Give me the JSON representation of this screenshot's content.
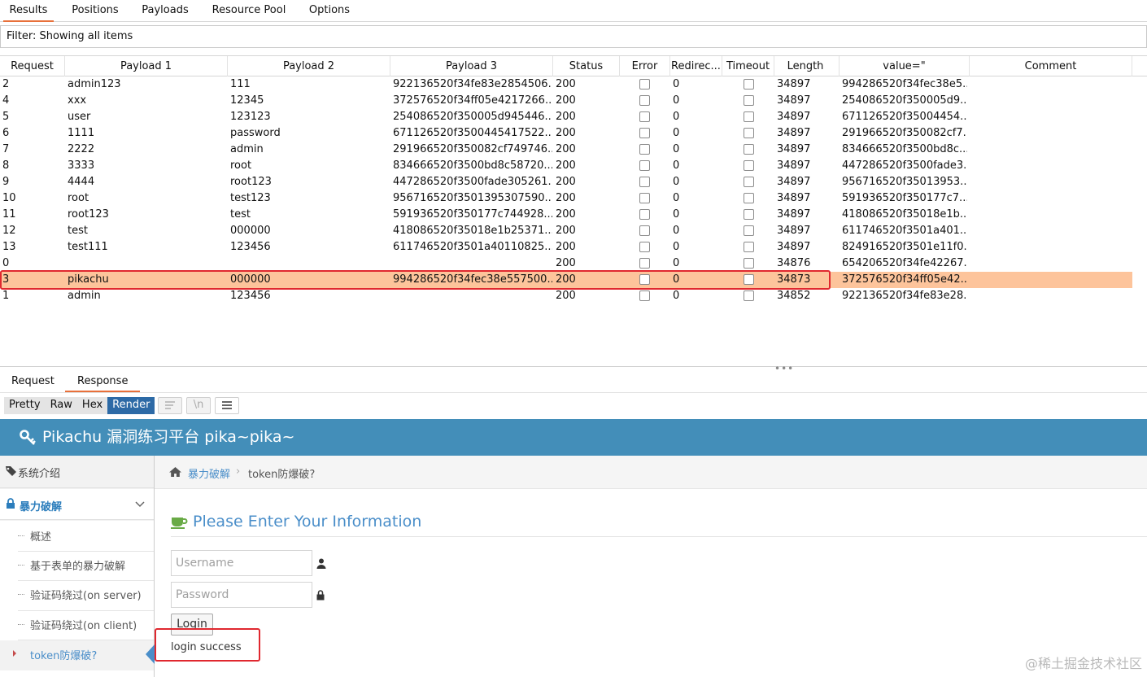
{
  "top_tabs": [
    "Results",
    "Positions",
    "Payloads",
    "Resource Pool",
    "Options"
  ],
  "filter": {
    "text": "Filter: Showing all items"
  },
  "table": {
    "columns": [
      "Request",
      "Payload 1",
      "Payload 2",
      "Payload 3",
      "Status",
      "Error",
      "Redirec...",
      "Timeout",
      "Length",
      "value=\"",
      "Comment"
    ],
    "sort_indicator": "⌄",
    "rows": [
      {
        "request": "2",
        "p1": "admin123",
        "p2": "111",
        "p3": "922136520f34fe83e2854506...",
        "status": "200",
        "redirects": "0",
        "length": "34897",
        "value": "994286520f34fec38e5...",
        "selected": false
      },
      {
        "request": "4",
        "p1": "xxx",
        "p2": "12345",
        "p3": "372576520f34ff05e4217266...",
        "status": "200",
        "redirects": "0",
        "length": "34897",
        "value": "254086520f350005d9...",
        "selected": false
      },
      {
        "request": "5",
        "p1": "user",
        "p2": "123123",
        "p3": "254086520f350005d945446...",
        "status": "200",
        "redirects": "0",
        "length": "34897",
        "value": "671126520f35004454...",
        "selected": false
      },
      {
        "request": "6",
        "p1": "1111",
        "p2": "password",
        "p3": "671126520f3500445417522...",
        "status": "200",
        "redirects": "0",
        "length": "34897",
        "value": "291966520f350082cf7...",
        "selected": false
      },
      {
        "request": "7",
        "p1": "2222",
        "p2": "admin",
        "p3": "291966520f350082cf749746...",
        "status": "200",
        "redirects": "0",
        "length": "34897",
        "value": "834666520f3500bd8c...",
        "selected": false
      },
      {
        "request": "8",
        "p1": "3333",
        "p2": "root",
        "p3": "834666520f3500bd8c58720...",
        "status": "200",
        "redirects": "0",
        "length": "34897",
        "value": "447286520f3500fade3...",
        "selected": false
      },
      {
        "request": "9",
        "p1": "4444",
        "p2": "root123",
        "p3": "447286520f3500fade305261...",
        "status": "200",
        "redirects": "0",
        "length": "34897",
        "value": "956716520f35013953...",
        "selected": false
      },
      {
        "request": "10",
        "p1": "root",
        "p2": "test123",
        "p3": "956716520f3501395307590...",
        "status": "200",
        "redirects": "0",
        "length": "34897",
        "value": "591936520f350177c7...",
        "selected": false
      },
      {
        "request": "11",
        "p1": "root123",
        "p2": "test",
        "p3": "591936520f350177c744928...",
        "status": "200",
        "redirects": "0",
        "length": "34897",
        "value": "418086520f35018e1b...",
        "selected": false
      },
      {
        "request": "12",
        "p1": "test",
        "p2": "000000",
        "p3": "418086520f35018e1b25371...",
        "status": "200",
        "redirects": "0",
        "length": "34897",
        "value": "611746520f3501a401...",
        "selected": false
      },
      {
        "request": "13",
        "p1": "test111",
        "p2": "123456",
        "p3": "611746520f3501a40110825...",
        "status": "200",
        "redirects": "0",
        "length": "34897",
        "value": "824916520f3501e11f0...",
        "selected": false
      },
      {
        "request": "0",
        "p1": "",
        "p2": "",
        "p3": "",
        "status": "200",
        "redirects": "0",
        "length": "34876",
        "value": "654206520f34fe42267...",
        "selected": false
      },
      {
        "request": "3",
        "p1": "pikachu",
        "p2": "000000",
        "p3": "994286520f34fec38e557500...",
        "status": "200",
        "redirects": "0",
        "length": "34873",
        "value": "372576520f34ff05e42...",
        "selected": true
      },
      {
        "request": "1",
        "p1": "admin",
        "p2": "123456",
        "p3": "",
        "status": "200",
        "redirects": "0",
        "length": "34852",
        "value": "922136520f34fe83e28...",
        "selected": false
      }
    ]
  },
  "splitter_dots": "•••",
  "rr_tabs": [
    "Request",
    "Response"
  ],
  "view_buttons": [
    "Pretty",
    "Raw",
    "Hex",
    "Render"
  ],
  "icon_buttons": [
    "wrap-lines-icon",
    "newline-icon",
    "menu-icon"
  ],
  "newline_label": "\\n",
  "rendered": {
    "title": "Pikachu 漏洞练习平台 pika~pika~",
    "sidebar": {
      "system_intro": "系统介绍",
      "brute_force": "暴力破解",
      "subitems": [
        "概述",
        "基于表单的暴力破解",
        "验证码绕过(on server)",
        "验证码绕过(on client)",
        "token防爆破?"
      ]
    },
    "breadcrumb": {
      "parent": "暴力破解",
      "separator": "›",
      "current": "token防爆破?"
    },
    "form": {
      "heading": "Please Enter Your Information",
      "username_placeholder": "Username",
      "password_placeholder": "Password",
      "login_label": "Login",
      "result": "login success"
    },
    "watermark": "@稀土掘金技术社区"
  },
  "colors": {
    "accent": "#e8703a",
    "selected_row": "#fdc49b",
    "highlight_box": "#e0282f",
    "header_blue": "#438eb9",
    "render_active": "#2d6aa6",
    "link_blue": "#4a8ec9"
  }
}
